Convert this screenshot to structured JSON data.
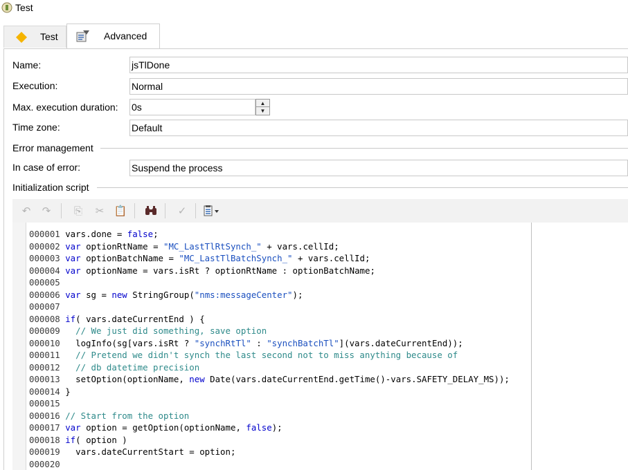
{
  "window": {
    "title": "Test"
  },
  "tabs": [
    {
      "label": "Test",
      "icon": "diamond-icon",
      "color": "#f5b400"
    },
    {
      "label": "Advanced",
      "icon": "properties-icon"
    }
  ],
  "form": {
    "name_label": "Name:",
    "name_value": "jsTlDone",
    "execution_label": "Execution:",
    "execution_value": "Normal",
    "max_duration_label": "Max. execution duration:",
    "max_duration_value": "0s",
    "timezone_label": "Time zone:",
    "timezone_value": "Default",
    "error_group_label": "Error management",
    "on_error_label": "In case of error:",
    "on_error_value": "Suspend the process",
    "init_script_label": "Initialization script"
  },
  "toolbar": {
    "buttons": [
      "undo-icon",
      "redo-icon",
      "copy-icon",
      "cut-icon",
      "paste-icon",
      "find-icon",
      "check-icon",
      "insert-menu-icon"
    ]
  },
  "code_lines": [
    {
      "num": "000001",
      "text": "vars.done = false;"
    },
    {
      "num": "000002",
      "text": "var optionRtName = \"MC_LastTlRtSynch_\" + vars.cellId;"
    },
    {
      "num": "000003",
      "text": "var optionBatchName = \"MC_LastTlBatchSynch_\" + vars.cellId;"
    },
    {
      "num": "000004",
      "text": "var optionName = vars.isRt ? optionRtName : optionBatchName;"
    },
    {
      "num": "000005",
      "text": ""
    },
    {
      "num": "000006",
      "text": "var sg = new StringGroup(\"nms:messageCenter\");"
    },
    {
      "num": "000007",
      "text": ""
    },
    {
      "num": "000008",
      "text": "if( vars.dateCurrentEnd ) {"
    },
    {
      "num": "000009",
      "text": "  // We just did something, save option"
    },
    {
      "num": "000010",
      "text": "  logInfo(sg[vars.isRt ? \"synchRtTl\" : \"synchBatchTl\"](vars.dateCurrentEnd));"
    },
    {
      "num": "000011",
      "text": "  // Pretend we didn't synch the last second not to miss anything because of"
    },
    {
      "num": "000012",
      "text": "  // db datetime precision"
    },
    {
      "num": "000013",
      "text": "  setOption(optionName, new Date(vars.dateCurrentEnd.getTime()-vars.SAFETY_DELAY_MS));"
    },
    {
      "num": "000014",
      "text": "}"
    },
    {
      "num": "000015",
      "text": ""
    },
    {
      "num": "000016",
      "text": "// Start from the option"
    },
    {
      "num": "000017",
      "text": "var option = getOption(optionName, false);"
    },
    {
      "num": "000018",
      "text": "if( option )"
    },
    {
      "num": "000019",
      "text": "  vars.dateCurrentStart = option;"
    },
    {
      "num": "000020",
      "text": ""
    }
  ]
}
